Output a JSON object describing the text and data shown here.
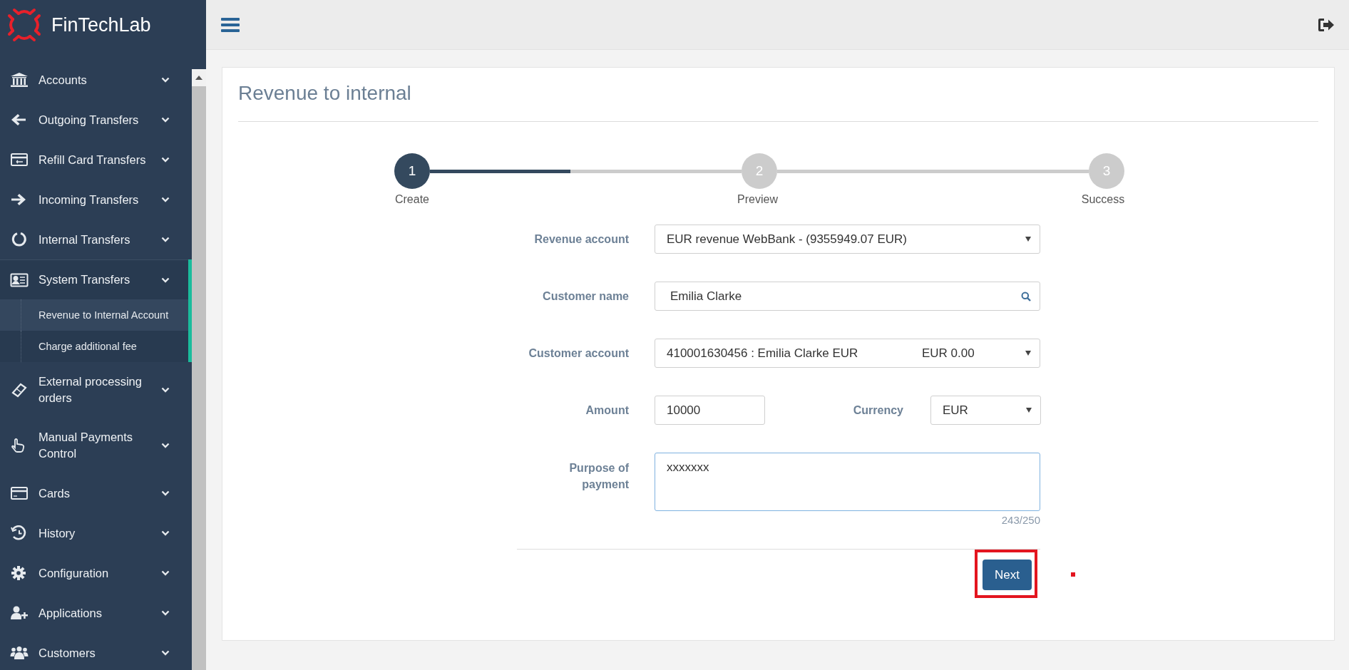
{
  "brand": {
    "name": "FinTechLab"
  },
  "sidebar": {
    "items": [
      {
        "label": "Accounts",
        "expanded": false
      },
      {
        "label": "Outgoing Transfers",
        "expanded": false
      },
      {
        "label": "Refill Card Transfers",
        "expanded": false
      },
      {
        "label": "Incoming Transfers",
        "expanded": false
      },
      {
        "label": "Internal Transfers",
        "expanded": false
      },
      {
        "label": "System Transfers",
        "expanded": true,
        "children": [
          {
            "label": "Revenue to Internal Account",
            "selected": true
          },
          {
            "label": "Charge additional fee",
            "selected": false
          }
        ]
      },
      {
        "label": "External processing orders",
        "expanded": false
      },
      {
        "label": "Manual Payments Control",
        "expanded": false
      },
      {
        "label": "Cards",
        "expanded": false
      },
      {
        "label": "History",
        "expanded": false
      },
      {
        "label": "Configuration",
        "expanded": false
      },
      {
        "label": "Applications",
        "expanded": false
      },
      {
        "label": "Customers",
        "expanded": false
      }
    ]
  },
  "page": {
    "title": "Revenue to internal"
  },
  "steps": [
    {
      "number": "1",
      "label": "Create",
      "selected": true
    },
    {
      "number": "2",
      "label": "Preview",
      "selected": false
    },
    {
      "number": "3",
      "label": "Success",
      "selected": false
    }
  ],
  "progress": {
    "level": 0.45
  },
  "form": {
    "revenue_account": {
      "label": "Revenue account",
      "value": "EUR revenue WebBank - (9355949.07 EUR)"
    },
    "customer_name": {
      "label": "Customer name",
      "value": "Emilia Clarke"
    },
    "customer_account": {
      "label": "Customer account",
      "value": "410001630456 : Emilia Clarke EUR",
      "balance": "EUR 0.00"
    },
    "amount": {
      "label": "Amount",
      "value": "10000"
    },
    "currency": {
      "label": "Currency",
      "value": "EUR"
    },
    "purpose": {
      "label": "Purpose of payment",
      "value": "xxxxxxx",
      "counter": "243/250"
    }
  },
  "buttons": {
    "next": "Next"
  }
}
